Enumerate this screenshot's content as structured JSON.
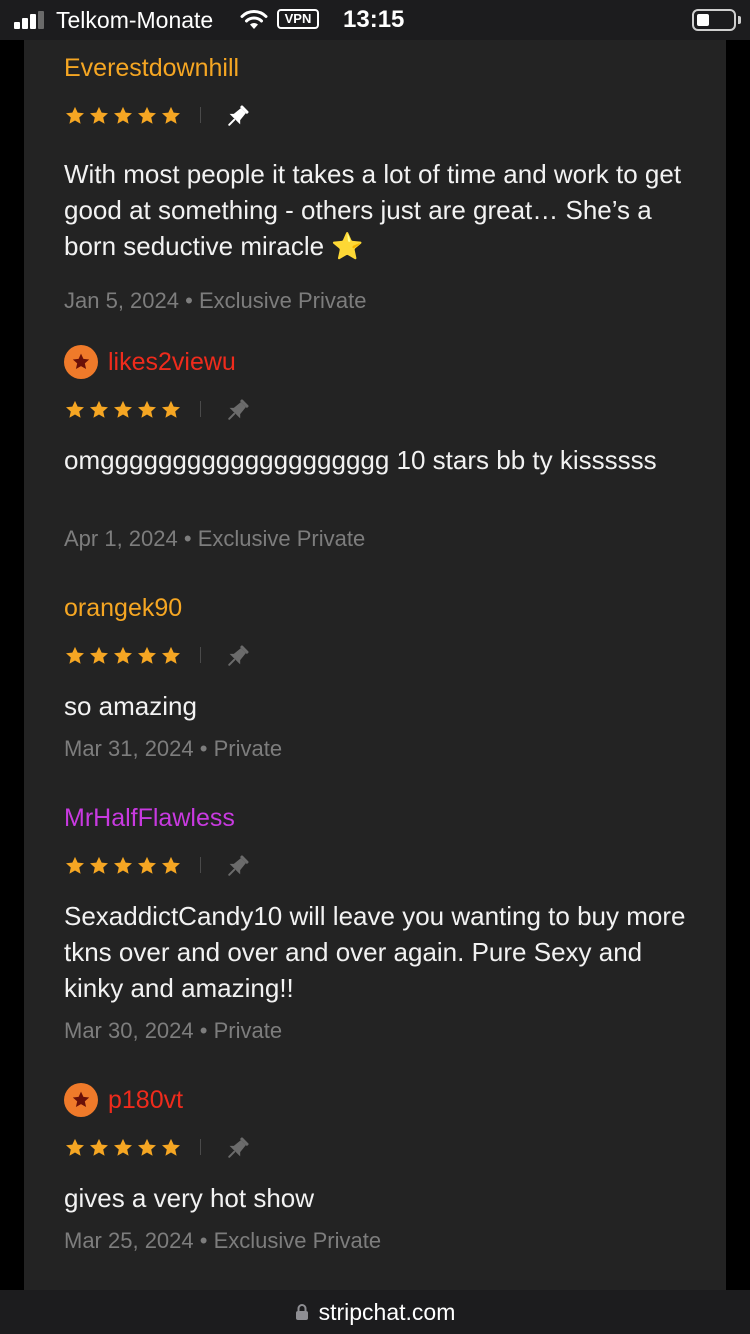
{
  "status_bar": {
    "carrier": "Telkom-Monate",
    "vpn_label": "VPN",
    "time": "13:15"
  },
  "colors": {
    "star": "#f5a623",
    "pin_active": "#ffffff",
    "pin_inactive": "#6b6b6b",
    "username_orange": "#f5a623",
    "username_red": "#ef2b1c",
    "username_purple": "#c83ae0",
    "avatar_bg": "#ef7a2a"
  },
  "reviews": [
    {
      "username": "Everestdownhill",
      "username_color": "#f5a623",
      "has_avatar": false,
      "rating": 5,
      "pinned": true,
      "text": "With most people it takes a lot of time and work to get good at something - others just are great… She’s a born seductive miracle ⭐",
      "date": "Jan 5, 2024",
      "show_type": "Exclusive Private"
    },
    {
      "username": "likes2viewu",
      "username_color": "#ef2b1c",
      "has_avatar": true,
      "rating": 5,
      "pinned": false,
      "text": "omgggggggggggggggggggg 10 stars bb ty kissssss",
      "date": "Apr 1, 2024",
      "show_type": "Exclusive Private"
    },
    {
      "username": "orangek90",
      "username_color": "#f5a623",
      "has_avatar": false,
      "rating": 5,
      "pinned": false,
      "text": "so amazing",
      "date": "Mar 31, 2024",
      "show_type": "Private"
    },
    {
      "username": "MrHalfFlawless",
      "username_color": "#c83ae0",
      "has_avatar": false,
      "rating": 5,
      "pinned": false,
      "text": "SexaddictCandy10 will leave you wanting to buy more tkns over and over and over again. Pure Sexy and kinky and amazing!!",
      "date": "Mar 30, 2024",
      "show_type": "Private"
    },
    {
      "username": "p180vt",
      "username_color": "#ef2b1c",
      "has_avatar": true,
      "rating": 5,
      "pinned": false,
      "text": "gives a very hot show",
      "date": "Mar 25, 2024",
      "show_type": "Exclusive Private"
    }
  ],
  "url_bar": {
    "domain": "stripchat.com"
  }
}
